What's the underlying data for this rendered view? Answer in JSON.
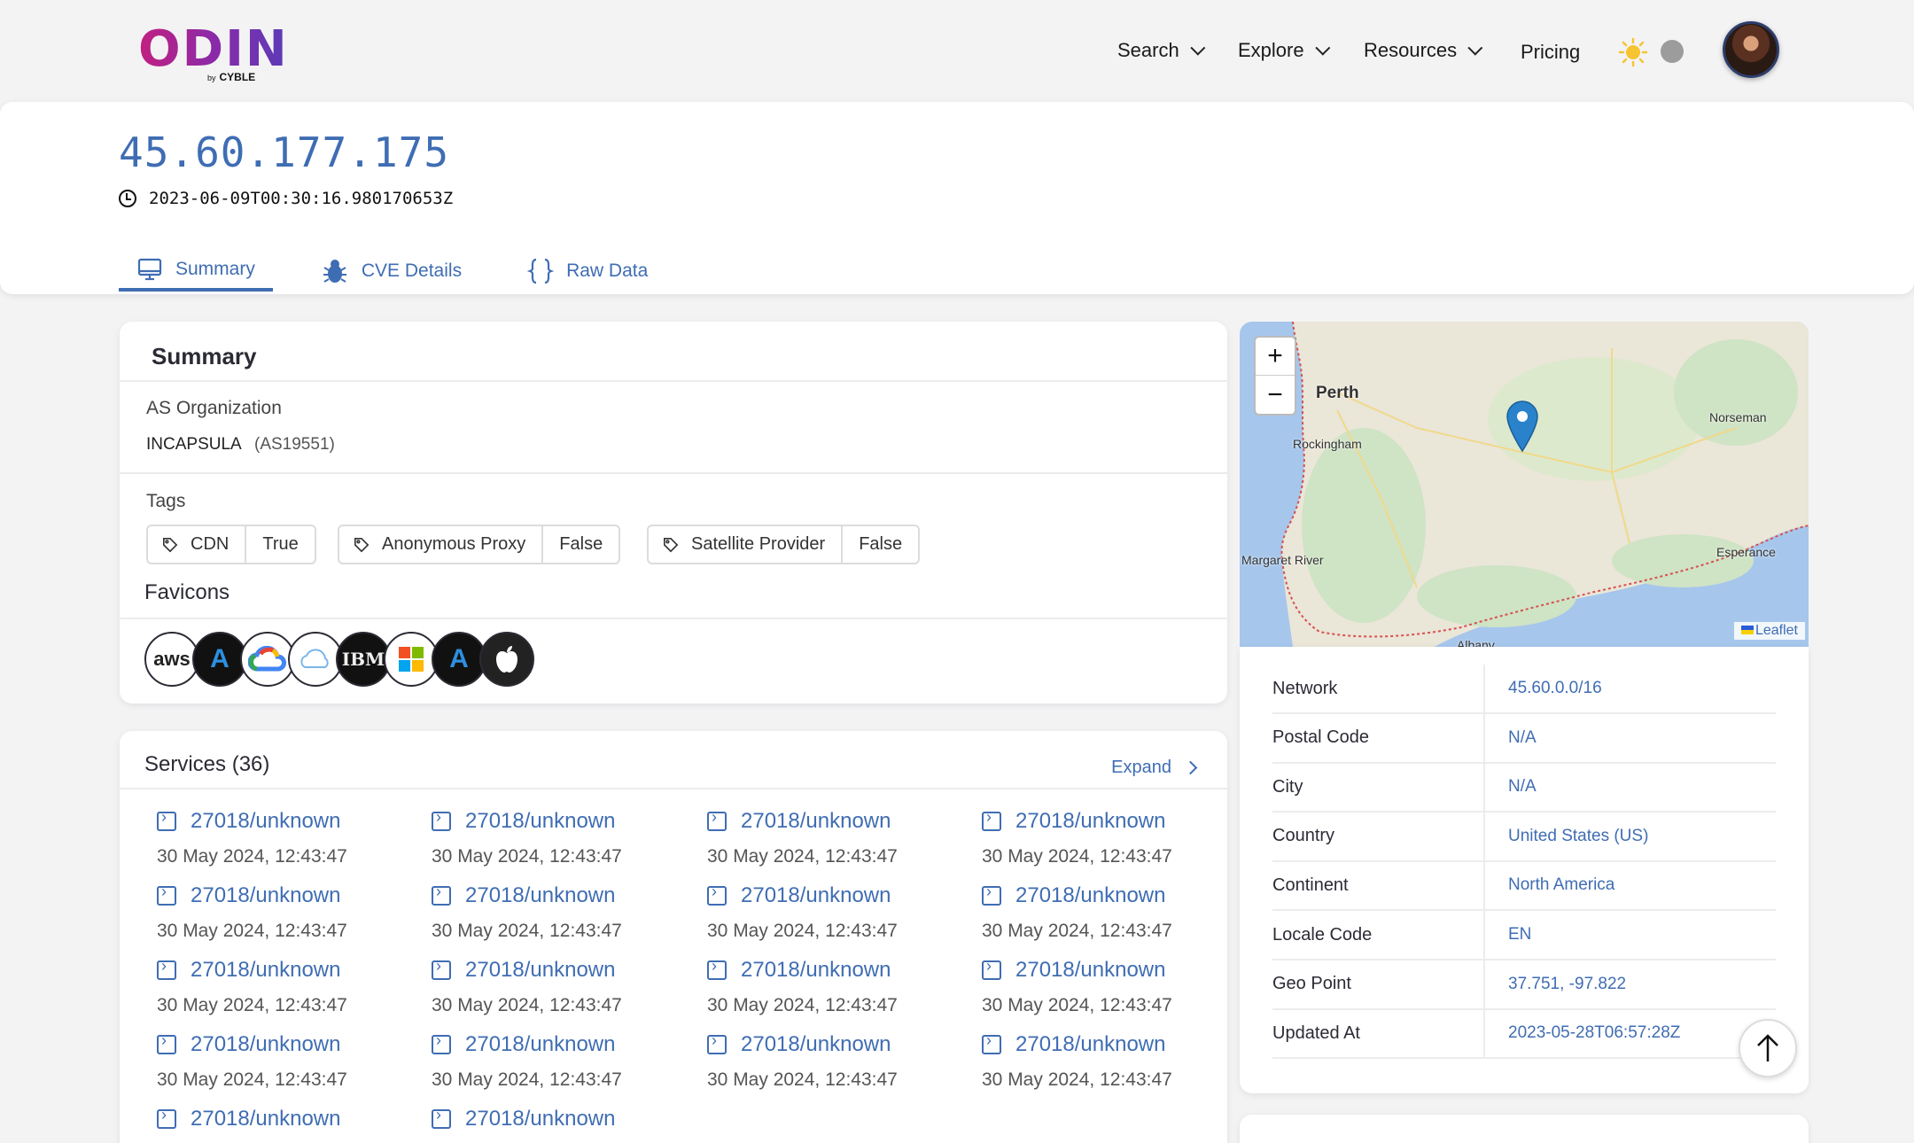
{
  "brand": {
    "name": "ODIN",
    "by": "by",
    "company": "CYBLE"
  },
  "nav": {
    "search": "Search",
    "explore": "Explore",
    "resources": "Resources",
    "pricing": "Pricing"
  },
  "header": {
    "ip": "45.60.177.175",
    "timestamp": "2023-06-09T00:30:16.980170653Z",
    "tabs": [
      {
        "label": "Summary",
        "icon": "monitor-icon",
        "active": true
      },
      {
        "label": "CVE Details",
        "icon": "bug-icon"
      },
      {
        "label": "Raw Data",
        "icon": "braces-icon"
      }
    ]
  },
  "summary": {
    "title": "Summary",
    "as_label": "AS Organization",
    "as_org": "INCAPSULA",
    "as_number": "(AS19551)",
    "tags_label": "Tags",
    "tags": [
      {
        "name": "CDN",
        "value": "True"
      },
      {
        "name": "Anonymous Proxy",
        "value": "False"
      },
      {
        "name": "Satellite Provider",
        "value": "False"
      }
    ],
    "favicons_label": "Favicons",
    "favicons": [
      {
        "icon": "aws-icon",
        "text": "aws"
      },
      {
        "icon": "azure-icon",
        "text": "A"
      },
      {
        "icon": "google-cloud-icon",
        "text": ""
      },
      {
        "icon": "ibm-cloud-icon",
        "text": ""
      },
      {
        "icon": "ibm-icon",
        "text": "IBM"
      },
      {
        "icon": "microsoft-icon",
        "text": ""
      },
      {
        "icon": "azure-icon",
        "text": "A"
      },
      {
        "icon": "apple-icon",
        "text": ""
      }
    ]
  },
  "services": {
    "title": "Services (36)",
    "expand": "Expand",
    "items": [
      {
        "port": "27018/unknown",
        "date": "30 May 2024, 12:43:47"
      },
      {
        "port": "27018/unknown",
        "date": "30 May 2024, 12:43:47"
      },
      {
        "port": "27018/unknown",
        "date": "30 May 2024, 12:43:47"
      },
      {
        "port": "27018/unknown",
        "date": "30 May 2024, 12:43:47"
      },
      {
        "port": "27018/unknown",
        "date": "30 May 2024, 12:43:47"
      },
      {
        "port": "27018/unknown",
        "date": "30 May 2024, 12:43:47"
      },
      {
        "port": "27018/unknown",
        "date": "30 May 2024, 12:43:47"
      },
      {
        "port": "27018/unknown",
        "date": "30 May 2024, 12:43:47"
      },
      {
        "port": "27018/unknown",
        "date": "30 May 2024, 12:43:47"
      },
      {
        "port": "27018/unknown",
        "date": "30 May 2024, 12:43:47"
      },
      {
        "port": "27018/unknown",
        "date": "30 May 2024, 12:43:47"
      },
      {
        "port": "27018/unknown",
        "date": "30 May 2024, 12:43:47"
      },
      {
        "port": "27018/unknown",
        "date": "30 May 2024, 12:43:47"
      },
      {
        "port": "27018/unknown",
        "date": "30 May 2024, 12:43:47"
      },
      {
        "port": "27018/unknown",
        "date": "30 May 2024, 12:43:47"
      },
      {
        "port": "27018/unknown",
        "date": "30 May 2024, 12:43:47"
      },
      {
        "port": "27018/unknown",
        "date": ""
      },
      {
        "port": "27018/unknown",
        "date": ""
      }
    ]
  },
  "map": {
    "zoom_in": "+",
    "zoom_out": "−",
    "labels": [
      "Perth",
      "Rockingham",
      "Norseman",
      "Margaret River",
      "Esperance",
      "Albany"
    ],
    "attribution": "Leaflet"
  },
  "geo": {
    "rows": [
      {
        "key": "Network",
        "value": "45.60.0.0/16"
      },
      {
        "key": "Postal Code",
        "value": "N/A"
      },
      {
        "key": "City",
        "value": "N/A"
      },
      {
        "key": "Country",
        "value": "United States (US)"
      },
      {
        "key": "Continent",
        "value": "North America"
      },
      {
        "key": "Locale Code",
        "value": "EN"
      },
      {
        "key": "Geo Point",
        "value": "37.751, -97.822"
      },
      {
        "key": "Updated At",
        "value": "2023-05-28T06:57:28Z"
      }
    ]
  },
  "colors": {
    "accent": "#3f6db3",
    "brand_start": "#c2207f",
    "brand_end": "#5b3bb8"
  }
}
